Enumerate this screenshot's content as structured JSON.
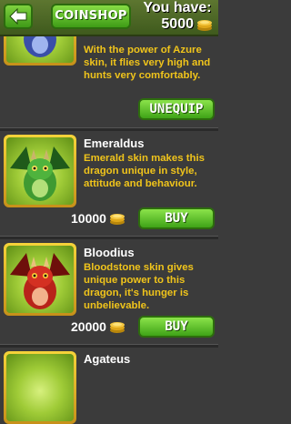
{
  "header": {
    "coinshop_label": "COINSHOP",
    "you_have_label": "You have:",
    "balance": "5000",
    "back_icon": "arrow-left-icon",
    "coin_icon": "coin-stack-icon"
  },
  "items": [
    {
      "name": "",
      "description": "With the power of Azure skin, it flies very high and hunts very comfortably.",
      "price": "",
      "action_label": "UNEQUIP",
      "skin_color": "#3a4fa8"
    },
    {
      "name": "Emeraldus",
      "description": "Emerald skin makes this dragon unique in style, attitude and behaviour.",
      "price": "10000",
      "action_label": "BUY",
      "skin_color": "#4aa83a"
    },
    {
      "name": "Bloodius",
      "description": "Bloodstone skin gives unique power to this dragon, it's hunger is unbelievable.",
      "price": "20000",
      "action_label": "BUY",
      "skin_color": "#c0241c"
    },
    {
      "name": "Agateus",
      "description": "",
      "price": "",
      "action_label": "",
      "skin_color": "#b07a3a"
    }
  ],
  "colors": {
    "accent_green": "#4fb020",
    "description_yellow": "#f0c41b",
    "frame_gold": "#e8b52a"
  }
}
